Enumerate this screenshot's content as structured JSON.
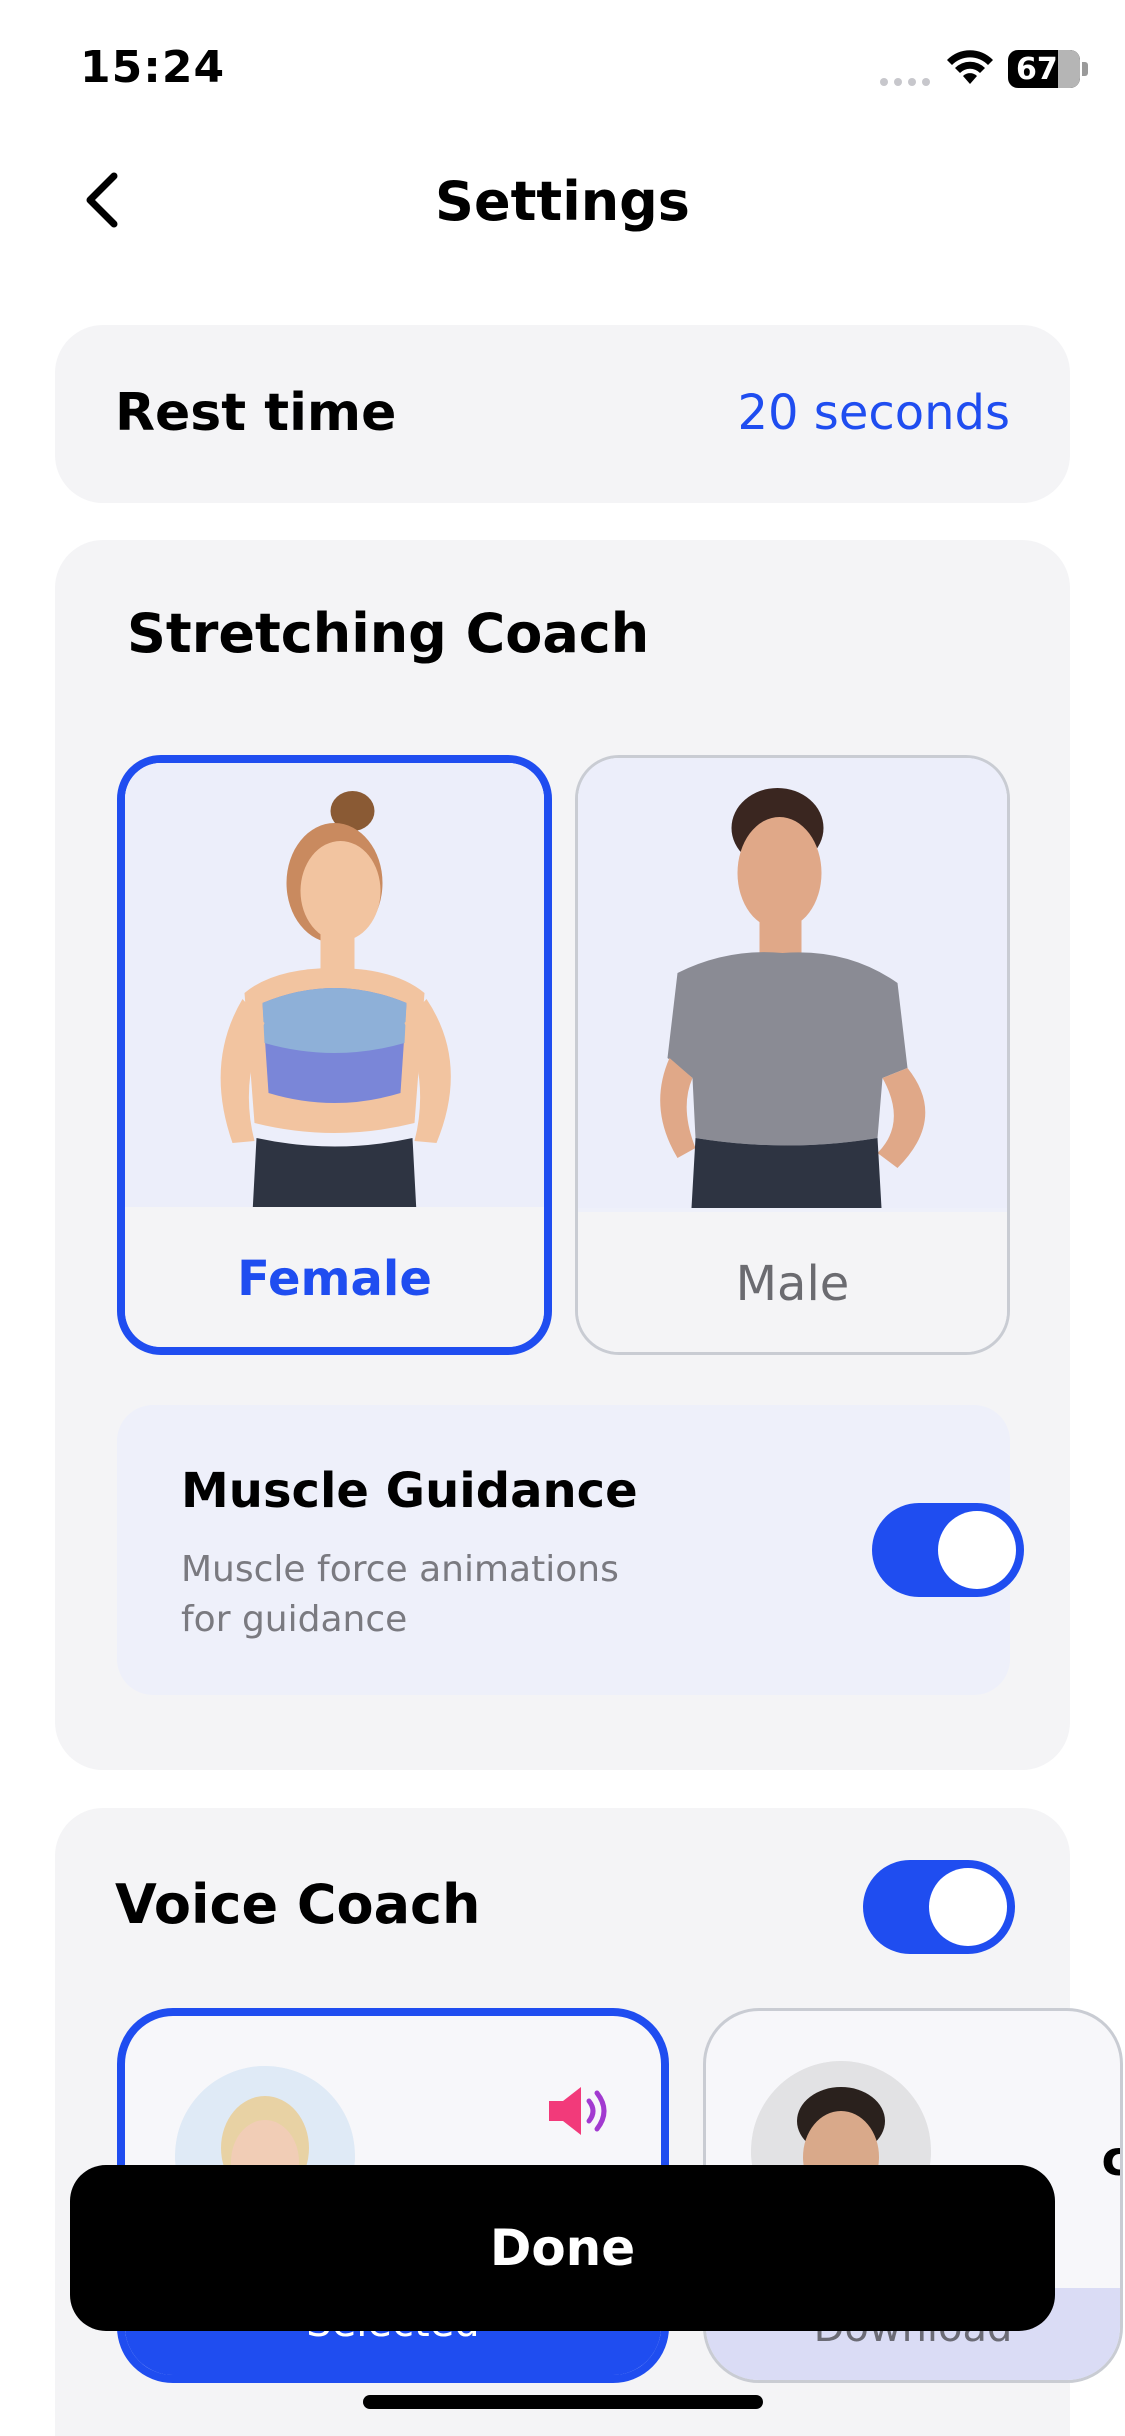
{
  "status_bar": {
    "time": "15:24",
    "battery": "67"
  },
  "nav": {
    "title": "Settings"
  },
  "rest_time": {
    "label": "Rest time",
    "value": "20 seconds"
  },
  "stretching_coach": {
    "title": "Stretching Coach",
    "options": [
      {
        "label": "Female",
        "selected": true
      },
      {
        "label": "Male",
        "selected": false
      }
    ],
    "muscle_guidance": {
      "title": "Muscle Guidance",
      "description": "Muscle force animations for guidance",
      "enabled": true
    }
  },
  "voice_coach": {
    "title": "Voice Coach",
    "enabled": true,
    "options": [
      {
        "button": "Selected",
        "selected": true
      },
      {
        "button": "Download",
        "selected": false,
        "name_fragment": "c"
      }
    ]
  },
  "footer": {
    "done_label": "Done"
  },
  "colors": {
    "accent": "#1f4df0",
    "card_bg": "#f4f4f6",
    "panel_bg": "#eef0fa"
  }
}
